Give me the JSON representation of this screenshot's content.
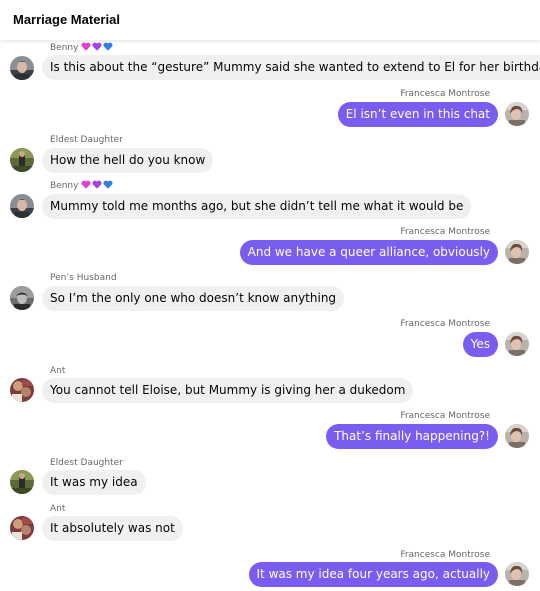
{
  "chat": {
    "title": "Marriage Material"
  },
  "colors": {
    "outgoing_bubble": "#7b5cf0",
    "incoming_bubble": "#f0f0f0",
    "sender_name": "#65676b"
  },
  "messages": [
    {
      "sender": "Benny",
      "hearts": [
        "pink-heart",
        "purple-heart",
        "blue-heart"
      ],
      "text": "Is this about the “gesture” Mummy said she wanted to extend to El for her birthday",
      "direction": "in",
      "avatar": "benny-avatar"
    },
    {
      "sender": "Francesca Montrose",
      "text": "El isn’t even in this chat",
      "direction": "out",
      "avatar": "francesca-avatar"
    },
    {
      "sender": "Eldest Daughter",
      "text": "How the hell do you know",
      "direction": "in",
      "avatar": "eldest-daughter-avatar"
    },
    {
      "sender": "Benny",
      "hearts": [
        "pink-heart",
        "purple-heart",
        "blue-heart"
      ],
      "text": "Mummy told me months ago, but she didn’t tell me what it would be",
      "direction": "in",
      "avatar": "benny-avatar"
    },
    {
      "sender": "Francesca Montrose",
      "text": "And we have a queer alliance, obviously",
      "direction": "out",
      "avatar": "francesca-avatar"
    },
    {
      "sender": "Pen’s Husband",
      "text": "So I’m the only one who doesn’t know anything",
      "direction": "in",
      "avatar": "pens-husband-avatar"
    },
    {
      "sender": "Francesca Montrose",
      "text": "Yes",
      "direction": "out",
      "avatar": "francesca-avatar"
    },
    {
      "sender": "Ant",
      "text": "You cannot tell Eloise, but Mummy is giving her a dukedom",
      "direction": "in",
      "avatar": "ant-avatar"
    },
    {
      "sender": "Francesca Montrose",
      "text": "That’s finally happening?!",
      "direction": "out",
      "avatar": "francesca-avatar"
    },
    {
      "sender": "Eldest Daughter",
      "text": "It was my idea",
      "direction": "in",
      "avatar": "eldest-daughter-avatar"
    },
    {
      "sender": "Ant",
      "text": "It absolutely was not",
      "direction": "in",
      "avatar": "ant-avatar"
    },
    {
      "sender": "Francesca Montrose",
      "text": "It was my idea four years ago, actually",
      "direction": "out",
      "avatar": "francesca-avatar"
    }
  ]
}
